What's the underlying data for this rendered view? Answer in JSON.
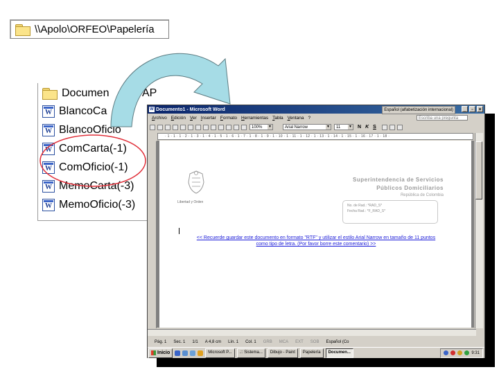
{
  "path_box": {
    "path": "\\\\Apolo\\ORFEO\\Papelería"
  },
  "file_list": {
    "items": [
      {
        "label": "Documen",
        "icon": "folder-icon"
      },
      {
        "label": "BlancoCa",
        "icon": "word-doc-icon"
      },
      {
        "label": "BlancoOficio",
        "icon": "word-doc-icon"
      },
      {
        "label": "ComCarta(-1)",
        "icon": "word-doc-icon"
      },
      {
        "label": "ComOficio(-1)",
        "icon": "word-doc-icon"
      },
      {
        "label": "MemoCarta(-3)",
        "icon": "word-doc-icon"
      },
      {
        "label": "MemoOficio(-3)",
        "icon": "word-doc-icon"
      }
    ],
    "overlap_text": "AP"
  },
  "highlight_color": "#e0303a",
  "arrow_color": "#a6dce6",
  "word": {
    "title": "Documento1 - Microsoft Word",
    "language_box": "Español (alfabetización internacional)",
    "window_buttons": [
      "_",
      "▫",
      "×"
    ],
    "menu": [
      "Archivo",
      "Edición",
      "Ver",
      "Insertar",
      "Formato",
      "Herramientas",
      "Tabla",
      "Ventana",
      "?"
    ],
    "help_placeholder": "Escriba una pregunta",
    "toolbar": {
      "zoom": "100%",
      "font": "Arial Narrow",
      "size": "11",
      "bold": "N",
      "italic": "K",
      "underline": "S"
    },
    "ruler": "· 1 · 1 · 1 · 2 · 1 · 3 · 1 · 4 · 1 · 5 · 1 · 6 · 1 · 7 · 1 · 8 · 1 · 9 · 1 · 10 · 1 · 11 · 1 · 12 · 1 · 13 · 1 · 14 · 1 · 15 · 1 · 16 · 17 · 1 · 18 ·",
    "document": {
      "crest_caption": "Libertad y Orden",
      "org_line1": "Superintendencia de Servicios",
      "org_line2": "Públicos Domiciliarios",
      "org_line3": "República de Colombia",
      "rad_no": "No. de Rad.: *RAD_S*",
      "rad_fecha": "Fecha Rad.: *F_RAD_S*",
      "notice_line1": "<< Recuerde guardar este documento en formato \"RTF\" y utilizar el estilo Arial Narrow en tamaño de 11 puntos",
      "notice_line2": "como tipo de letra. (Por favor borre este comentario) >>"
    },
    "status": {
      "page": "Pág. 1",
      "section": "Sec. 1",
      "pages": "1/1",
      "position": "A 4,8 cm",
      "line": "Lín. 1",
      "column": "Col. 1",
      "grb": "GRB",
      "mca": "MCA",
      "ext": "EXT",
      "sob": "SOB",
      "lang": "Español (Co"
    },
    "taskbar": {
      "start": "Inicio",
      "tasks": [
        "Microsoft P...",
        ".:: Sistema...",
        "Dibujo - Paint",
        "Papelería",
        "Documen..."
      ],
      "clock": "9:31"
    }
  }
}
